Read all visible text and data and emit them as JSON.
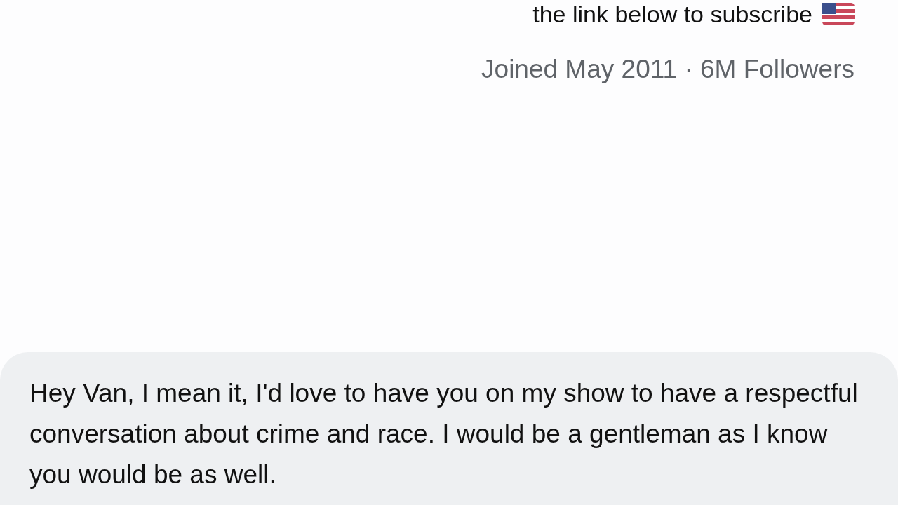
{
  "profile": {
    "bio_line": "the link below to subscribe",
    "meta": "Joined May 2011 · 6M Followers"
  },
  "message": {
    "text": "Hey Van, I mean it, I'd love to have you on my show to have a respectful conversation about crime and race. I would be a gentleman as I know you would be as well."
  }
}
